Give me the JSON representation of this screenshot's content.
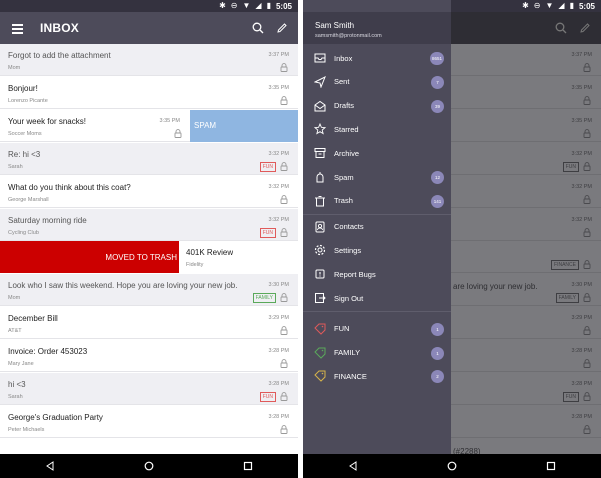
{
  "status": {
    "time": "5:05"
  },
  "inbox": {
    "title": "INBOX",
    "rows": [
      {
        "subject": "Forgot to add the attachment",
        "sender": "Mom",
        "time": "3:37 PM",
        "read": true,
        "label": ""
      },
      {
        "subject": "Bonjour!",
        "sender": "Lorenzo Picante",
        "time": "3:35 PM",
        "read": false,
        "label": ""
      },
      {
        "subject": "Your week for snacks!",
        "sender": "Soccer Moms",
        "time": "3:35 PM",
        "read": false,
        "label": "",
        "swipe": "spam"
      },
      {
        "subject": "Re: hi <3",
        "sender": "Sarah",
        "time": "3:32 PM",
        "read": true,
        "label": "FUN"
      },
      {
        "subject": "What do you think about this coat?",
        "sender": "George Marshall",
        "time": "3:32 PM",
        "read": false,
        "label": ""
      },
      {
        "subject": "Saturday morning ride",
        "sender": "Cycling Club",
        "time": "3:32 PM",
        "read": true,
        "label": "FUN"
      },
      {
        "subject": "401K Review",
        "sender": "Fidelity",
        "time": "",
        "read": false,
        "label": "",
        "swipe": "trash"
      },
      {
        "subject": "Look who I saw this weekend. Hope you are loving your new job.",
        "sender": "Mom",
        "time": "3:30 PM",
        "read": true,
        "label": "FAMILY"
      },
      {
        "subject": "December Bill",
        "sender": "AT&T",
        "time": "3:29 PM",
        "read": false,
        "label": ""
      },
      {
        "subject": "Invoice: Order 453023",
        "sender": "Mary Jane",
        "time": "3:28 PM",
        "read": false,
        "label": ""
      },
      {
        "subject": "hi <3",
        "sender": "Sarah",
        "time": "3:28 PM",
        "read": true,
        "label": "FUN"
      },
      {
        "subject": "George's Graduation Party",
        "sender": "Peter Michaels",
        "time": "3:28 PM",
        "read": false,
        "label": ""
      }
    ],
    "swipe_spam_label": "SPAM",
    "swipe_trash_label": "MOVED TO TRASH"
  },
  "drawer": {
    "user_name": "Sam Smith",
    "user_email": "samsmith@protonmail.com",
    "items": [
      {
        "label": "Inbox",
        "icon": "inbox-icon",
        "badge": "8651"
      },
      {
        "label": "Sent",
        "icon": "send-icon",
        "badge": "7"
      },
      {
        "label": "Drafts",
        "icon": "drafts-icon",
        "badge": "39"
      },
      {
        "label": "Starred",
        "icon": "star-icon",
        "badge": ""
      },
      {
        "label": "Archive",
        "icon": "archive-icon",
        "badge": ""
      },
      {
        "label": "Spam",
        "icon": "spam-icon",
        "badge": "12"
      },
      {
        "label": "Trash",
        "icon": "trash-icon",
        "badge": "141"
      }
    ],
    "secondary": [
      {
        "label": "Contacts",
        "icon": "contacts-icon"
      },
      {
        "label": "Settings",
        "icon": "settings-icon"
      },
      {
        "label": "Report Bugs",
        "icon": "bug-icon"
      },
      {
        "label": "Sign Out",
        "icon": "sign-out-icon"
      }
    ],
    "labels": [
      {
        "label": "FUN",
        "color": "#e05a5a",
        "badge": "1"
      },
      {
        "label": "FAMILY",
        "color": "#5aa95a",
        "badge": "1"
      },
      {
        "label": "FINANCE",
        "color": "#d7b44a",
        "badge": "2"
      }
    ]
  },
  "background": {
    "rows": [
      {
        "time": "3:37 PM",
        "label": ""
      },
      {
        "time": "3:35 PM",
        "label": ""
      },
      {
        "time": "3:35 PM",
        "label": ""
      },
      {
        "time": "3:32 PM",
        "label": "FUN"
      },
      {
        "time": "3:32 PM",
        "label": ""
      },
      {
        "time": "3:32 PM",
        "label": ""
      },
      {
        "time": "",
        "label": "FINANCE"
      },
      {
        "time": "3:30 PM",
        "label": "FAMILY",
        "snippet": "are loving your new job."
      },
      {
        "time": "3:29 PM",
        "label": ""
      },
      {
        "time": "3:28 PM",
        "label": ""
      },
      {
        "time": "3:28 PM",
        "label": "FUN"
      },
      {
        "time": "3:28 PM",
        "label": ""
      },
      {
        "time": "",
        "label": "",
        "snippet": "(#2288)"
      }
    ]
  },
  "colors": {
    "appbar": "#4d4b5a",
    "drawer": "#4d4b5a",
    "spam": "#8fb6e1",
    "trash": "#cc0000",
    "fun": "#e05a5a",
    "family": "#5aa95a",
    "finance": "#d7b44a"
  }
}
